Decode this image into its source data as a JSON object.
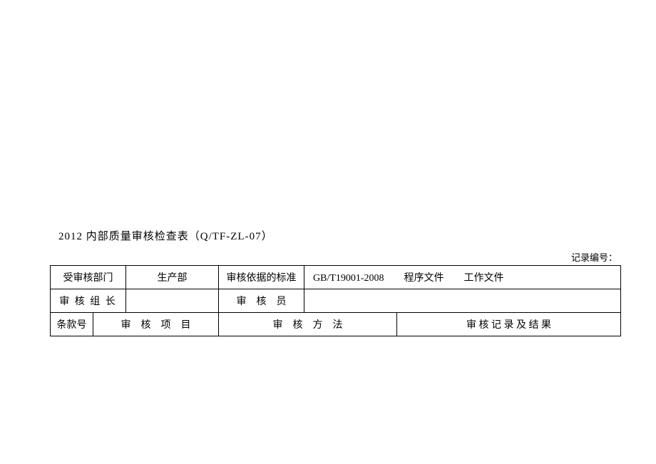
{
  "title": "2012 内部质量审核检查表（Q/TF-ZL-07）",
  "recordNoLabel": "记录编号：",
  "row1": {
    "deptLabel": "受审核部门",
    "deptValue": "生产部",
    "stdLabel": "审核依据的标准",
    "stdValue": "GB/T19001-2008　　程序文件　　工作文件"
  },
  "row2": {
    "leaderLabel": "审 核 组 长",
    "auditorLabel": "审　核　员"
  },
  "row3": {
    "clauseNo": "条款号",
    "auditItem": "审　核　项　目",
    "auditMethod": "审　核　方　法",
    "auditResult": "审 核 记 录 及 结 果"
  }
}
